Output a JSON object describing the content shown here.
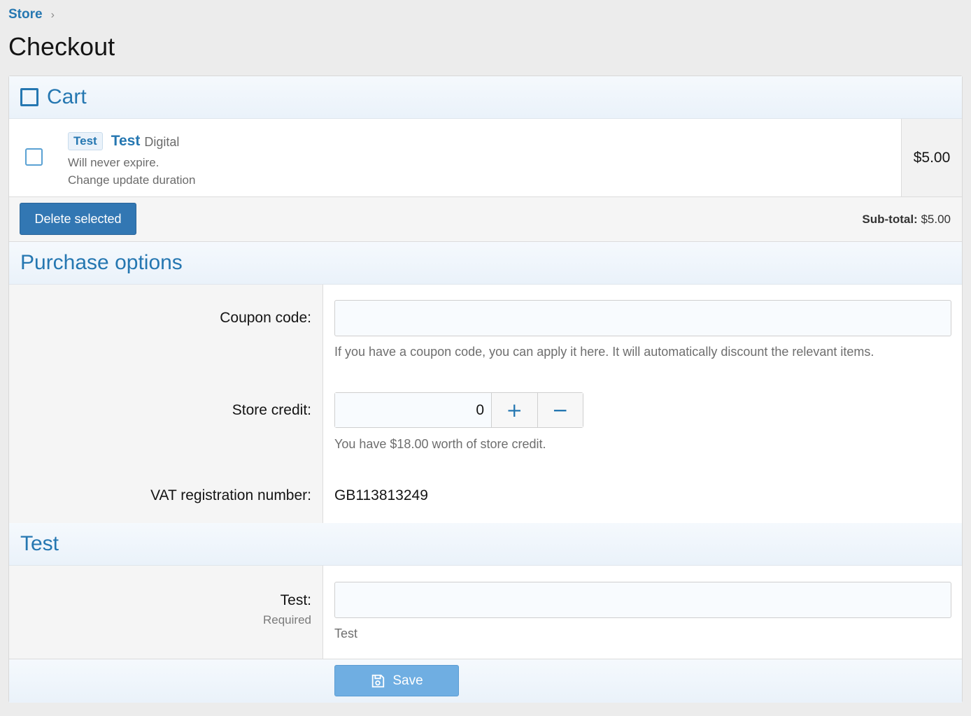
{
  "breadcrumb": {
    "store": "Store",
    "separator": "›"
  },
  "page_title": "Checkout",
  "cart": {
    "heading": "Cart",
    "item": {
      "badge": "Test",
      "name": "Test",
      "type": "Digital",
      "expiry": "Will never expire.",
      "change_link": "Change update duration",
      "price": "$5.00",
      "checked": false
    },
    "delete_label": "Delete selected",
    "subtotal_label": "Sub-total:",
    "subtotal_value": "$5.00"
  },
  "purchase_options": {
    "heading": "Purchase options",
    "coupon": {
      "label": "Coupon code:",
      "value": "",
      "hint": "If you have a coupon code, you can apply it here. It will automatically discount the relevant items."
    },
    "store_credit": {
      "label": "Store credit:",
      "value": "0",
      "plus": "+",
      "minus": "−",
      "hint": "You have $18.00 worth of store credit."
    },
    "vat": {
      "label": "VAT registration number:",
      "value": "GB113813249"
    }
  },
  "test_section": {
    "heading": "Test",
    "field": {
      "label": "Test:",
      "required": "Required",
      "value": "",
      "hint": "Test"
    }
  },
  "save_label": "Save",
  "colors": {
    "accent": "#2577b1",
    "button_primary": "#3277b3",
    "button_save": "#6faee2"
  },
  "icons": {
    "cart": "square-icon",
    "save": "floppy-disk-icon"
  }
}
